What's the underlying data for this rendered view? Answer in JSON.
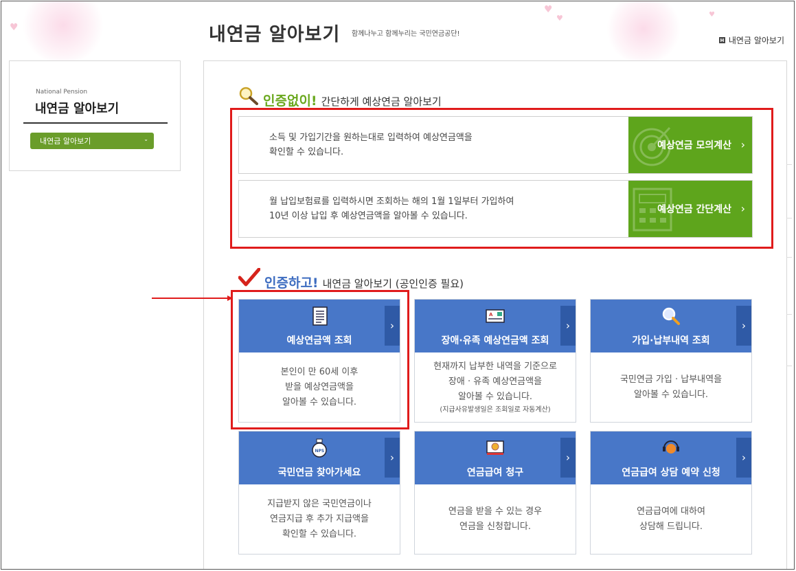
{
  "header": {
    "title": "내연금 알아보기",
    "tagline": "함께나누고 함께누리는 국민연금공단!",
    "home_link": "내연금 알아보기",
    "home_icon": "H"
  },
  "sidebar": {
    "subtitle": "National Pension",
    "title": "내연금 알아보기",
    "menu_button": "내연금 알아보기",
    "menu_chevron": "⌄"
  },
  "section_simple": {
    "highlight": "인증없이!",
    "text": "간단하게 예상연금 알아보기",
    "rows": [
      {
        "line1": "소득 및 가입기간을 원하는대로 입력하여 예상연금액을",
        "line2": "확인할 수 있습니다.",
        "button": "예상연금 모의계산",
        "arrow": "›"
      },
      {
        "line1": "월 납입보험료를 입력하시면 조회하는 해의 1월 1일부터 가입하여",
        "line2": "10년 이상 납입 후 예상연금액을 알아볼 수 있습니다.",
        "button": "예상연금 간단계산",
        "arrow": "›"
      }
    ]
  },
  "section_auth": {
    "highlight": "인증하고!",
    "text": "내연금 알아보기 (공인인증 필요)"
  },
  "cards": [
    {
      "label": "예상연금액 조회",
      "lines": [
        "본인이 만 60세 이후",
        "받을 예상연금액을",
        "알아볼 수 있습니다."
      ],
      "note": "",
      "arrow": "›"
    },
    {
      "label": "장애·유족 예상연금액 조회",
      "lines": [
        "현재까지 납부한 내역을 기준으로",
        "장애 · 유족 예상연금액을",
        "알아볼 수 있습니다."
      ],
      "note": "(지급사유발생일은 조회일로 자동계산)",
      "arrow": "›"
    },
    {
      "label": "가입·납부내역 조회",
      "lines": [
        "국민연금 가입 · 납부내역을",
        "알아볼 수 있습니다."
      ],
      "note": "",
      "arrow": "›"
    },
    {
      "label": "국민연금 찾아가세요",
      "lines": [
        "지급받지 않은 국민연금이나",
        "연금지급 후 추가 지급액을",
        "확인할 수 있습니다."
      ],
      "note": "",
      "arrow": "›"
    },
    {
      "label": "연금급여 청구",
      "lines": [
        "연금을 받을 수 있는 경우",
        "연금을 신청합니다."
      ],
      "note": "",
      "arrow": "›"
    },
    {
      "label": "연금급여 상담 예약 신청",
      "lines": [
        "연금급여에 대하여",
        "상담해 드립니다."
      ],
      "note": "",
      "arrow": "›"
    }
  ],
  "colors": {
    "green_accent": "#6aa81e",
    "green_button": "#5ea51c",
    "card_blue": "#4877c8",
    "card_tab": "#2f5aa6",
    "highlight_red": "#e01b1b"
  }
}
